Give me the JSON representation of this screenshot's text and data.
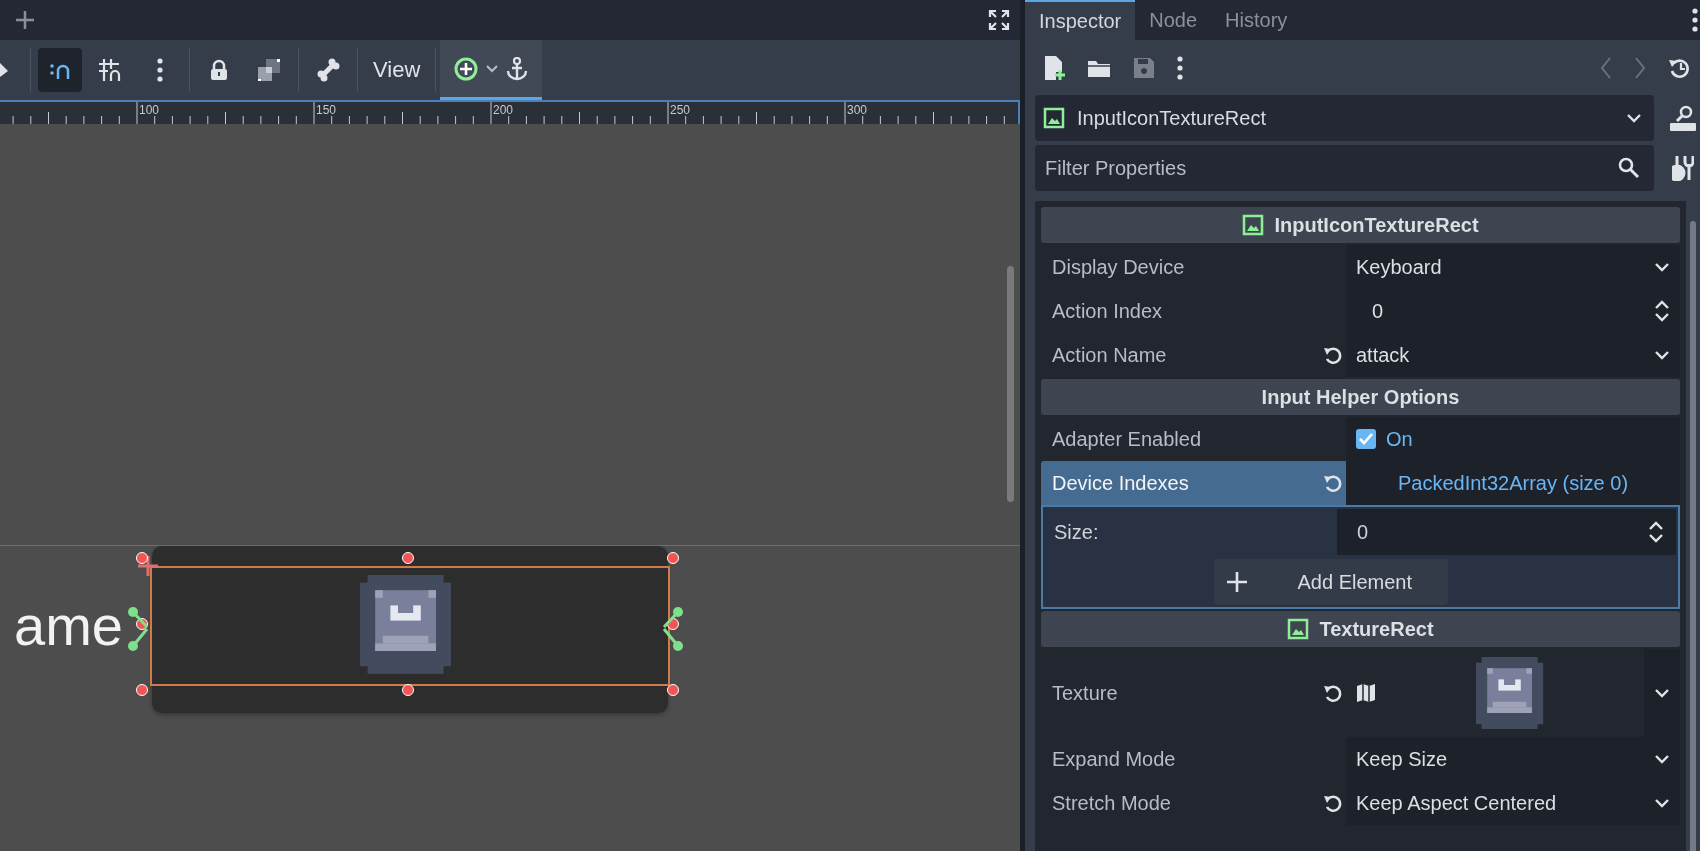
{
  "toolbar": {
    "items": [
      {
        "kind": "snap",
        "on": true
      },
      {
        "kind": "grid",
        "on": false
      },
      {
        "kind": "more"
      },
      {
        "kind": "lock"
      },
      {
        "kind": "group"
      },
      {
        "kind": "bone"
      },
      {
        "kind": "menu",
        "label": "View"
      },
      {
        "kind": "anchor-group",
        "on": true
      }
    ]
  },
  "ruler": {
    "labels": [
      "100",
      "150",
      "200",
      "250",
      "300"
    ]
  },
  "canvas": {
    "label_text": "ame"
  },
  "inspector": {
    "tabs": [
      {
        "label": "Inspector",
        "selected": true
      },
      {
        "label": "Node",
        "selected": false
      },
      {
        "label": "History",
        "selected": false
      }
    ],
    "node_selector": "InputIconTextureRect",
    "filter": {
      "placeholder": "Filter Properties"
    },
    "sections": [
      {
        "kind": "class",
        "title": "InputIconTextureRect",
        "rows": [
          {
            "kind": "dropdown",
            "label": "Display Device",
            "value": "Keyboard",
            "revertable": false,
            "selected": false
          },
          {
            "kind": "spin",
            "label": "Action Index",
            "value": "0",
            "revertable": false,
            "selected": false
          },
          {
            "kind": "dropdown",
            "label": "Action Name",
            "value": "attack",
            "revertable": true,
            "selected": false
          }
        ]
      },
      {
        "kind": "group",
        "title": "Input Helper Options",
        "rows": [
          {
            "kind": "checkbox",
            "label": "Adapter Enabled",
            "checked": true,
            "value": "On",
            "revertable": false,
            "selected": false
          },
          {
            "kind": "array",
            "label": "Device Indexes",
            "value": "PackedInt32Array (size 0)",
            "revertable": true,
            "selected": true,
            "expanded": true,
            "size_label": "Size:",
            "size_value": "0",
            "add_label": "Add Element"
          }
        ]
      },
      {
        "kind": "class",
        "title": "TextureRect",
        "rows": [
          {
            "kind": "texture",
            "label": "Texture",
            "revertable": true,
            "selected": false
          },
          {
            "kind": "dropdown",
            "label": "Expand Mode",
            "value": "Keep Size",
            "revertable": false,
            "selected": false
          },
          {
            "kind": "dropdown",
            "label": "Stretch Mode",
            "value": "Keep Aspect Centered",
            "revertable": true,
            "selected": false
          }
        ]
      }
    ]
  }
}
